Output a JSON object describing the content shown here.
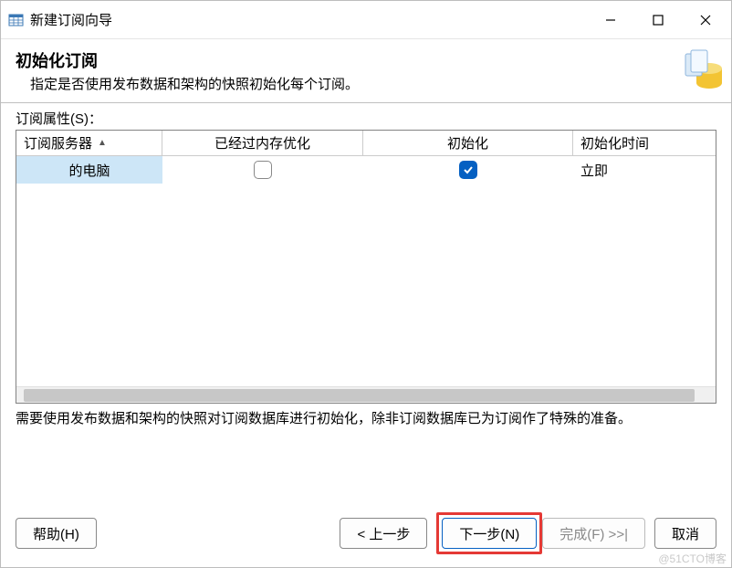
{
  "window": {
    "title": "新建订阅向导"
  },
  "header": {
    "title": "初始化订阅",
    "subtitle": "指定是否使用发布数据和架构的快照初始化每个订阅。"
  },
  "grid": {
    "label": "订阅属性(S)：",
    "columns": {
      "c1": "订阅服务器",
      "c2": "已经过内存优化",
      "c3": "初始化",
      "c4": "初始化时间"
    },
    "row": {
      "server": "的电脑",
      "memopt": false,
      "init": true,
      "time": "立即"
    }
  },
  "note": "需要使用发布数据和架构的快照对订阅数据库进行初始化，除非订阅数据库已为订阅作了特殊的准备。",
  "buttons": {
    "help": "帮助(H)",
    "back": "< 上一步",
    "next": "下一步(N)",
    "finish": "完成(F) >>|",
    "cancel": "取消"
  },
  "watermark": "@51CTO博客"
}
